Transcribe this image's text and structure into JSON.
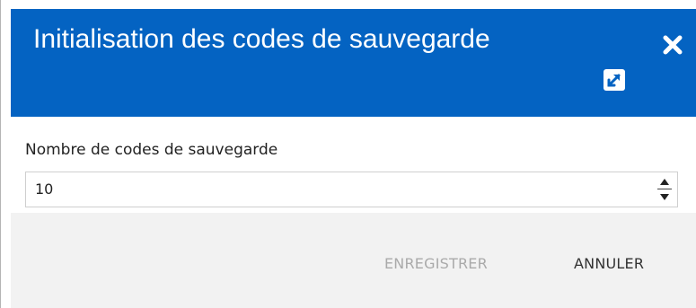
{
  "dialog": {
    "title": "Initialisation des codes de sauvegarde",
    "close_icon": "close-icon",
    "expand_icon": "expand-icon",
    "header_color": "#0463c2"
  },
  "form": {
    "backup_codes_count": {
      "label": "Nombre de codes de sauvegarde",
      "value": "10",
      "increment_icon": "spinner-up-icon",
      "decrement_icon": "spinner-down-icon"
    }
  },
  "footer": {
    "save_label": "ENREGISTRER",
    "save_enabled": false,
    "cancel_label": "ANNULER"
  }
}
